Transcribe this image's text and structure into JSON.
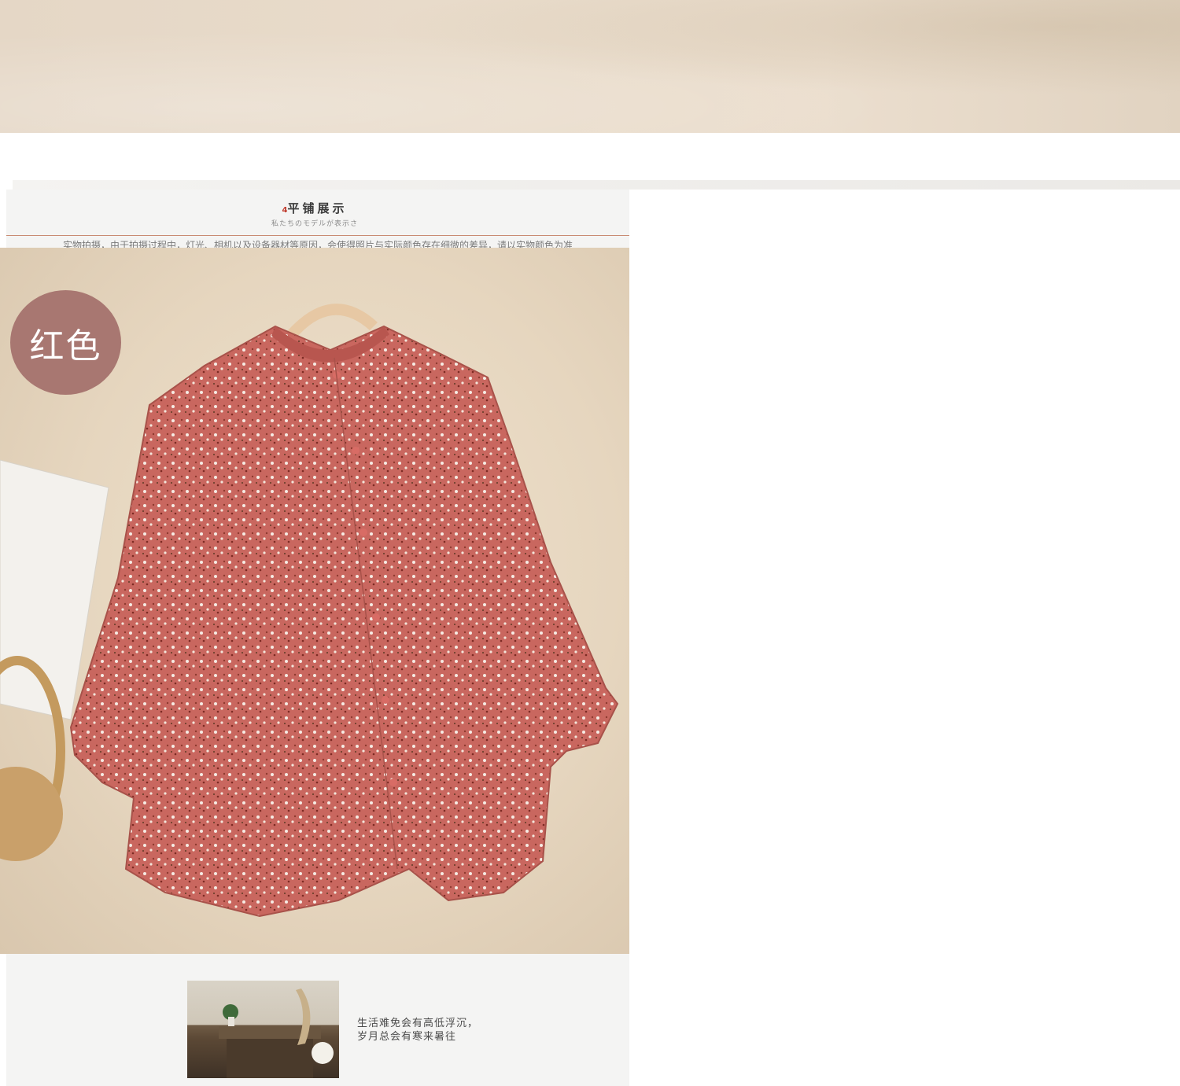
{
  "section": {
    "title": "平铺展示",
    "title_marker": "4",
    "subtitle": "私たちのモデルが表示さ",
    "notice": "实物拍摄，由于拍摄过程中，灯光、相机以及设备器材等原因，会使得照片与实际颜色存在细微的差异，请以实物颜色为准"
  },
  "product": {
    "color_label": "红色",
    "colors": {
      "badge": "#a87771",
      "fabric": "#c9675f",
      "background": "#e6d6bf"
    }
  },
  "footer": {
    "caption_line1": "生活难免会有高低浮沉，",
    "caption_line2": "岁月总会有寒来暑往"
  }
}
